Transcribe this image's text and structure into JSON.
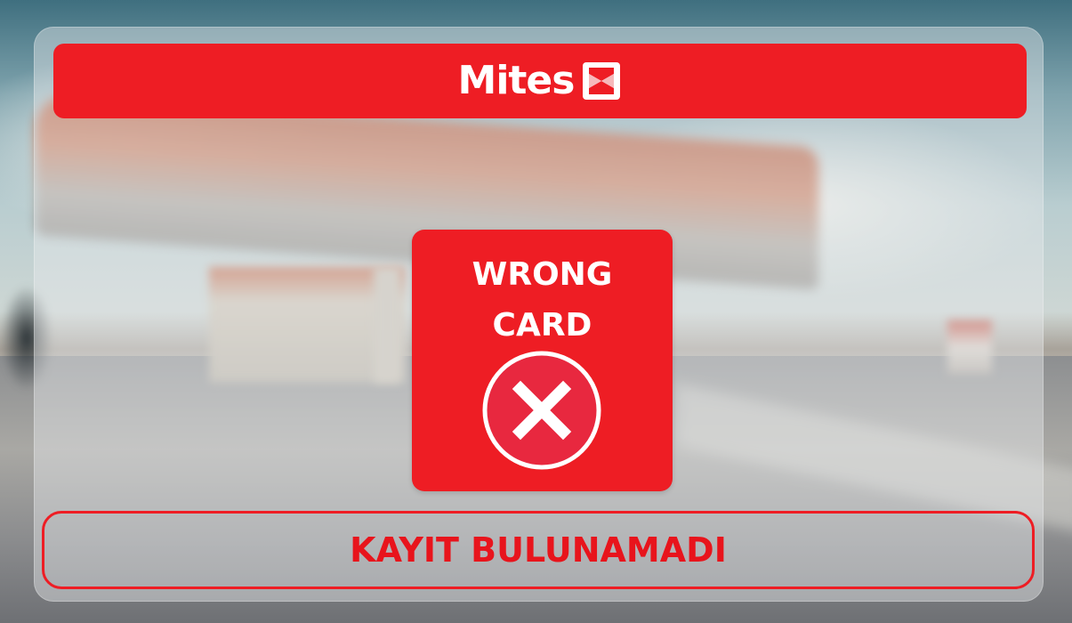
{
  "brand": {
    "name": "Mites",
    "logo_icon": "mites-hourglass-logo-icon",
    "color": "#ee1d24"
  },
  "error_card": {
    "title_line1": "WRONG",
    "title_line2": "CARD",
    "icon": "close-circle-icon"
  },
  "status": {
    "message": "KAYIT BULUNAMADI"
  },
  "background": {
    "description_icon": "gas-station-background-image"
  }
}
